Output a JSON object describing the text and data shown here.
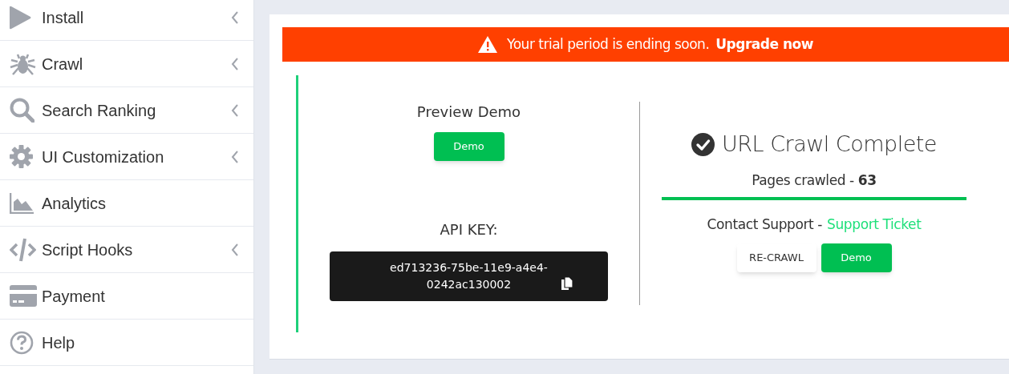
{
  "sidebar": {
    "items": [
      {
        "label": "Install",
        "has_submenu": true
      },
      {
        "label": "Crawl",
        "has_submenu": true
      },
      {
        "label": "Search Ranking",
        "has_submenu": true
      },
      {
        "label": "UI Customization",
        "has_submenu": true
      },
      {
        "label": "Analytics",
        "has_submenu": false
      },
      {
        "label": "Script Hooks",
        "has_submenu": true
      },
      {
        "label": "Payment",
        "has_submenu": false
      },
      {
        "label": "Help",
        "has_submenu": false
      }
    ]
  },
  "banner": {
    "message": "Your trial period is ending soon.",
    "link": "Upgrade now"
  },
  "preview": {
    "title": "Preview Demo",
    "button": "Demo"
  },
  "api_key": {
    "label": "API KEY:",
    "value": "ed713236-75be-11e9-a4e4-0242ac130002"
  },
  "status": {
    "title": "URL Crawl Complete",
    "pages": "Pages crawled - **63**",
    "support_text": "Contact Support -",
    "support_link": "Support Ticket",
    "buttons": [
      "RE-CRAWL",
      "Demo"
    ]
  }
}
